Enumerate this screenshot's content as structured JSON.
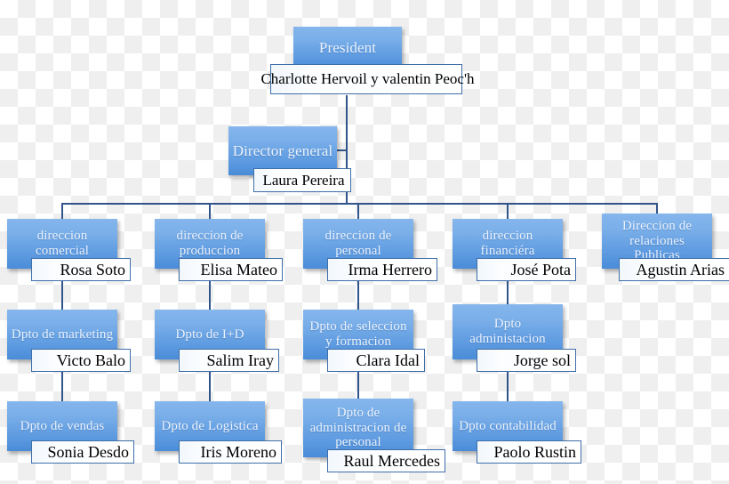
{
  "chart": {
    "type": "org-chart",
    "background": "transparency-checkerboard",
    "accent_color": "#5d9ae0",
    "line_color": "#31558b",
    "nodes": [
      {
        "id": "president",
        "title": "President",
        "name": "Charlotte Hervoil y valentin Peoc'h",
        "level": 0
      },
      {
        "id": "director-general",
        "title": "Director general",
        "name": "Laura Pereira",
        "level": 1
      },
      {
        "id": "direccion-comercial",
        "title": "direccion comercial",
        "name": "Rosa Soto",
        "level": 2
      },
      {
        "id": "direccion-de-produccion",
        "title": "direccion de produccion",
        "name": "Elisa Mateo",
        "level": 2
      },
      {
        "id": "direccion-de-personal",
        "title": "direccion de personal",
        "name": "Irma Herrero",
        "level": 2
      },
      {
        "id": "direccion-financiera",
        "title": "direccion financiéra",
        "name": "José Pota",
        "level": 2
      },
      {
        "id": "direccion-de-relaciones-publicas",
        "title": "Direccion de relaciones Publicas",
        "name": "Agustin Arias",
        "level": 2
      },
      {
        "id": "dpto-de-marketing",
        "title": "Dpto de marketing",
        "name": "Victo Balo",
        "level": 3
      },
      {
        "id": "dpto-de-i-d",
        "title": "Dpto de I+D",
        "name": "Salim Iray",
        "level": 3
      },
      {
        "id": "dpto-de-seleccion-y-formacion",
        "title": "Dpto de seleccion y formacion",
        "name": "Clara Idal",
        "level": 3
      },
      {
        "id": "dpto-administacion",
        "title": "Dpto administacion",
        "name": "Jorge sol",
        "level": 3
      },
      {
        "id": "dpto-de-vendas",
        "title": "Dpto de vendas",
        "name": "Sonia Desdo",
        "level": 4
      },
      {
        "id": "dpto-de-logistica",
        "title": "Dpto de Logistica",
        "name": "Iris Moreno",
        "level": 4
      },
      {
        "id": "dpto-de-administracion-de-personal",
        "title": "Dpto de administracion de personal",
        "name": "Raul Mercedes",
        "level": 4
      },
      {
        "id": "dpto-contabilidad",
        "title": "Dpto contabilidad",
        "name": "Paolo Rustin",
        "level": 4
      }
    ]
  }
}
